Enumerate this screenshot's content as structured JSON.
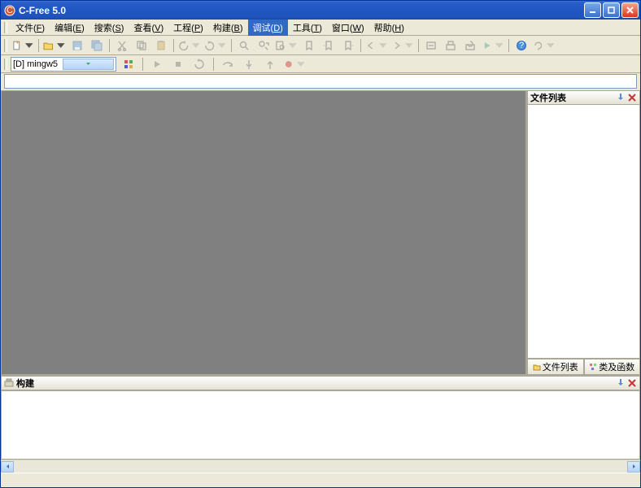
{
  "title": "C-Free 5.0",
  "menu": {
    "file": {
      "label": "文件",
      "key": "F"
    },
    "edit": {
      "label": "编辑",
      "key": "E"
    },
    "search": {
      "label": "搜索",
      "key": "S"
    },
    "view": {
      "label": "查看",
      "key": "V"
    },
    "project": {
      "label": "工程",
      "key": "P"
    },
    "build": {
      "label": "构建",
      "key": "B"
    },
    "debug": {
      "label": "调试",
      "key": "D"
    },
    "tools": {
      "label": "工具",
      "key": "T"
    },
    "window": {
      "label": "窗口",
      "key": "W"
    },
    "help": {
      "label": "帮助",
      "key": "H"
    }
  },
  "config_selector": "[D] mingw5",
  "address_value": "",
  "right_panel": {
    "title": "文件列表",
    "tabs": {
      "files": "文件列表",
      "classes": "类及函数"
    }
  },
  "output_panel": {
    "title": "构建"
  },
  "colors": {
    "titlebar": "#2a5fc9",
    "accent": "#316ac5",
    "workspace": "#808080"
  }
}
